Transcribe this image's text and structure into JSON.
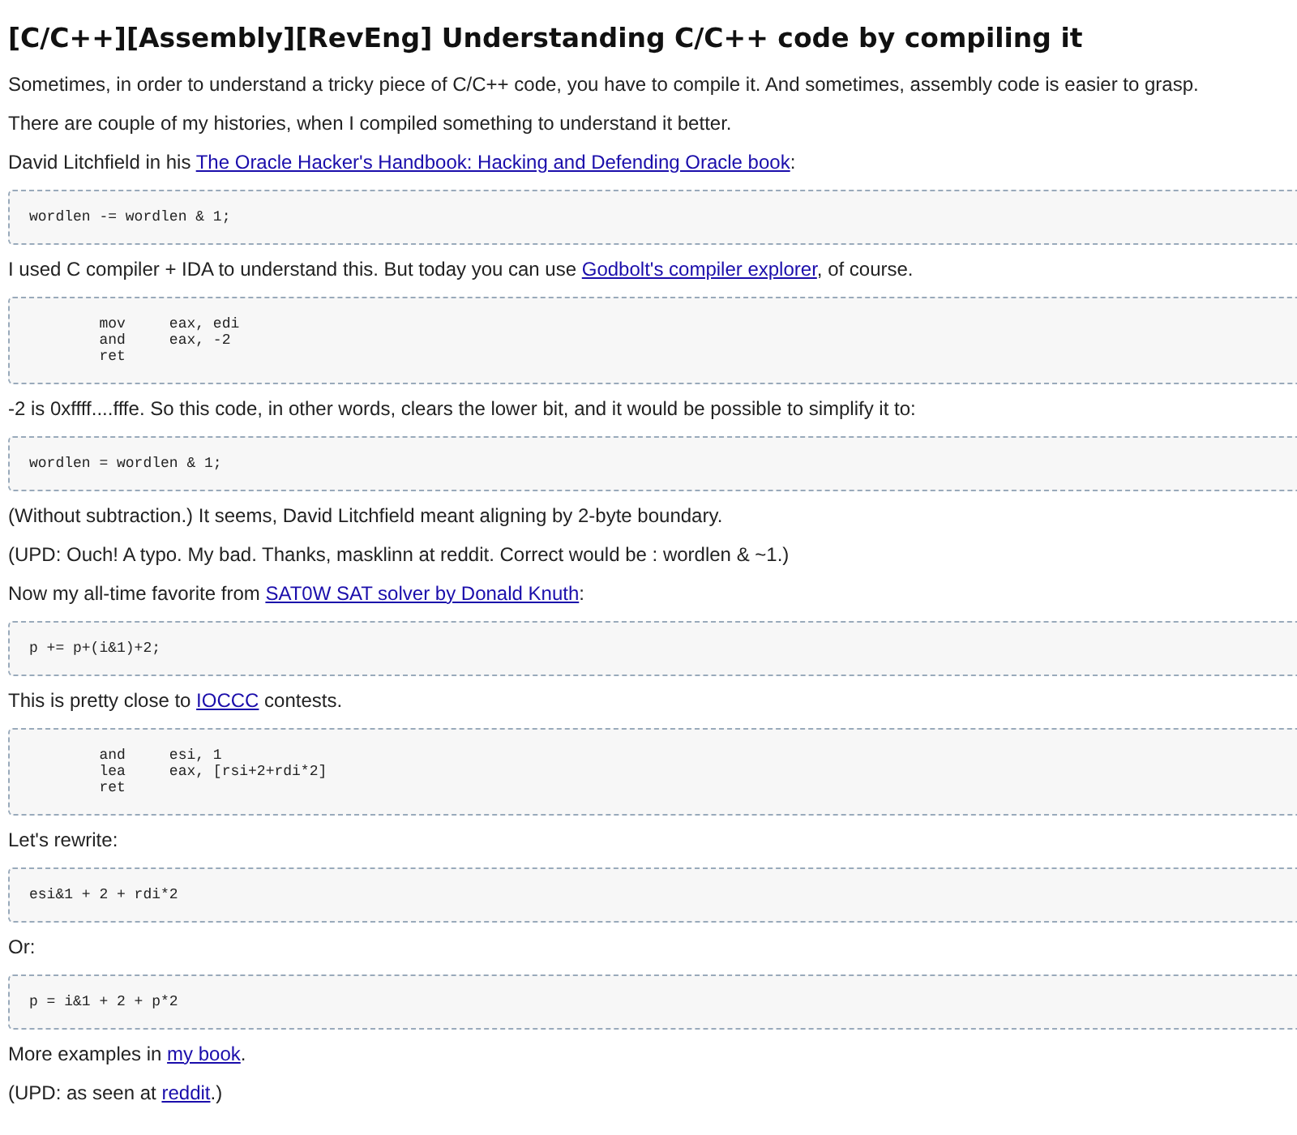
{
  "title": "[C/C++][Assembly][RevEng] Understanding C/C++ code by compiling it",
  "blocks": [
    {
      "kind": "paragraph",
      "parts": [
        {
          "text": "Sometimes, in order to understand a tricky piece of C/C++ code, you have to compile it. And sometimes, assembly code is easier to grasp.",
          "link": false
        }
      ]
    },
    {
      "kind": "paragraph",
      "parts": [
        {
          "text": "There are couple of my histories, when I compiled something to understand it better.",
          "link": false
        }
      ]
    },
    {
      "kind": "paragraph",
      "parts": [
        {
          "text": "David Litchfield in his ",
          "link": false
        },
        {
          "text": "The Oracle Hacker's Handbook: Hacking and Defending Oracle book",
          "link": true
        },
        {
          "text": ":",
          "link": false
        }
      ]
    },
    {
      "kind": "code",
      "lines": [
        "wordlen -= wordlen & 1;"
      ]
    },
    {
      "kind": "paragraph",
      "parts": [
        {
          "text": "I used C compiler + IDA to understand this. But today you can use ",
          "link": false
        },
        {
          "text": "Godbolt's compiler explorer",
          "link": true
        },
        {
          "text": ", of course.",
          "link": false
        }
      ]
    },
    {
      "kind": "code",
      "lines": [
        "        mov     eax, edi",
        "        and     eax, -2",
        "        ret"
      ]
    },
    {
      "kind": "paragraph",
      "parts": [
        {
          "text": "-2 is 0xffff....fffe. So this code, in other words, clears the lower bit, and it would be possible to simplify it to:",
          "link": false
        }
      ]
    },
    {
      "kind": "code",
      "lines": [
        "wordlen = wordlen & 1;"
      ]
    },
    {
      "kind": "paragraph",
      "parts": [
        {
          "text": "(Without subtraction.) It seems, David Litchfield meant aligning by 2-byte boundary.",
          "link": false
        }
      ]
    },
    {
      "kind": "paragraph",
      "parts": [
        {
          "text": "(UPD: Ouch! A typo. My bad. Thanks, masklinn at reddit. Correct would be : wordlen & ~1.)",
          "link": false
        }
      ]
    },
    {
      "kind": "paragraph",
      "parts": [
        {
          "text": "Now my all-time favorite from ",
          "link": false
        },
        {
          "text": "SAT0W SAT solver by Donald Knuth",
          "link": true
        },
        {
          "text": ":",
          "link": false
        }
      ]
    },
    {
      "kind": "code",
      "lines": [
        "p += p+(i&1)+2;"
      ]
    },
    {
      "kind": "paragraph",
      "parts": [
        {
          "text": "This is pretty close to ",
          "link": false
        },
        {
          "text": "IOCCC",
          "link": true
        },
        {
          "text": " contests.",
          "link": false
        }
      ]
    },
    {
      "kind": "code",
      "lines": [
        "        and     esi, 1",
        "        lea     eax, [rsi+2+rdi*2]",
        "        ret"
      ]
    },
    {
      "kind": "paragraph",
      "parts": [
        {
          "text": "Let's rewrite:",
          "link": false
        }
      ]
    },
    {
      "kind": "code",
      "lines": [
        "esi&1 + 2 + rdi*2"
      ]
    },
    {
      "kind": "paragraph",
      "parts": [
        {
          "text": "Or:",
          "link": false
        }
      ]
    },
    {
      "kind": "code",
      "lines": [
        "p = i&1 + 2 + p*2"
      ]
    },
    {
      "kind": "paragraph",
      "parts": [
        {
          "text": "More examples in ",
          "link": false
        },
        {
          "text": "my book",
          "link": true
        },
        {
          "text": ".",
          "link": false
        }
      ]
    },
    {
      "kind": "paragraph",
      "parts": [
        {
          "text": "(UPD: as seen at ",
          "link": false
        },
        {
          "text": "reddit",
          "link": true
        },
        {
          "text": ".)",
          "link": false
        }
      ]
    }
  ]
}
